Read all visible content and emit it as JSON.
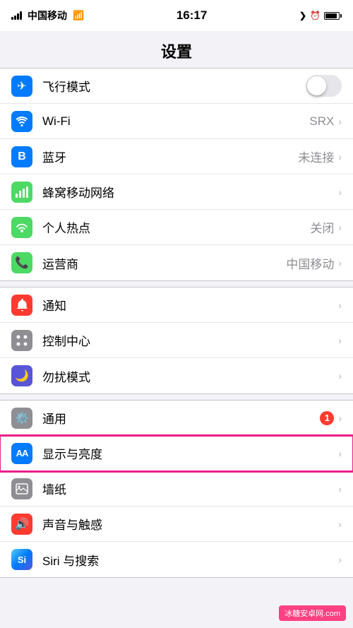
{
  "statusBar": {
    "carrier": "中国移动",
    "time": "16:17",
    "icons": [
      "location",
      "alarm",
      "battery"
    ]
  },
  "header": {
    "title": "设置"
  },
  "groups": [
    {
      "id": "network",
      "rows": [
        {
          "id": "airplane",
          "icon": "✈",
          "iconBg": "#007aff",
          "label": "飞行模式",
          "value": "",
          "type": "toggle",
          "toggleOn": false
        },
        {
          "id": "wifi",
          "icon": "wifi",
          "iconBg": "#007aff",
          "label": "Wi-Fi",
          "value": "SRX",
          "type": "chevron"
        },
        {
          "id": "bluetooth",
          "icon": "bluetooth",
          "iconBg": "#007aff",
          "label": "蓝牙",
          "value": "未连接",
          "type": "chevron"
        },
        {
          "id": "cellular",
          "icon": "cellular",
          "iconBg": "#4cd964",
          "label": "蜂窝移动网络",
          "value": "",
          "type": "chevron"
        },
        {
          "id": "hotspot",
          "icon": "hotspot",
          "iconBg": "#4cd964",
          "label": "个人热点",
          "value": "关闭",
          "type": "chevron"
        },
        {
          "id": "carrier",
          "icon": "phone",
          "iconBg": "#4cd964",
          "label": "运营商",
          "value": "中国移动",
          "type": "chevron"
        }
      ]
    },
    {
      "id": "notifications",
      "rows": [
        {
          "id": "notifications",
          "icon": "notify",
          "iconBg": "#ff3b30",
          "label": "通知",
          "value": "",
          "type": "chevron"
        },
        {
          "id": "control-center",
          "icon": "control",
          "iconBg": "#8e8e93",
          "label": "控制中心",
          "value": "",
          "type": "chevron"
        },
        {
          "id": "dnd",
          "icon": "moon",
          "iconBg": "#5856d6",
          "label": "勿扰模式",
          "value": "",
          "type": "chevron"
        }
      ]
    },
    {
      "id": "general",
      "rows": [
        {
          "id": "general",
          "icon": "gear",
          "iconBg": "#8e8e93",
          "label": "通用",
          "value": "",
          "badge": "1",
          "type": "chevron"
        },
        {
          "id": "display",
          "icon": "AA",
          "iconBg": "#007aff",
          "label": "显示与亮度",
          "value": "",
          "type": "chevron",
          "highlighted": true
        },
        {
          "id": "wallpaper",
          "icon": "wallpaper",
          "iconBg": "#8e8e93",
          "label": "墙纸",
          "value": "",
          "type": "chevron"
        },
        {
          "id": "sounds",
          "icon": "sounds",
          "iconBg": "#ff3b30",
          "label": "声音与触感",
          "value": "",
          "type": "chevron"
        },
        {
          "id": "siri",
          "icon": "siri",
          "iconBg": "#007aff",
          "label": "Siri 与搜索",
          "value": "",
          "type": "chevron"
        }
      ]
    }
  ],
  "watermark": "冰糖安卓网.com"
}
